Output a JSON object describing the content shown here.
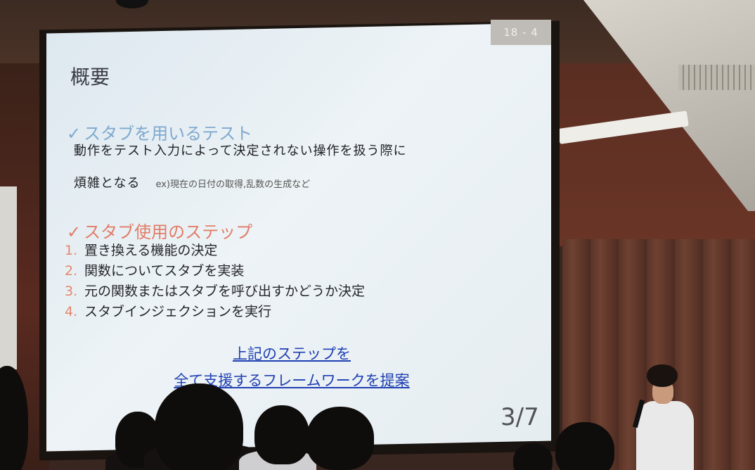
{
  "slide": {
    "slide_number": "18 - 4",
    "title": "概要",
    "section1": {
      "check": "✓",
      "heading": "スタブを用いるテスト",
      "line1": "動作をテスト入力によって決定されない操作を扱う際に",
      "line2": "煩雑となる",
      "example": "ex)現在の日付の取得,乱数の生成など"
    },
    "section2": {
      "check": "✓",
      "heading": "スタブ使用のステップ",
      "steps": [
        {
          "num": "1.",
          "text": "置き換える機能の決定"
        },
        {
          "num": "2.",
          "text": "関数についてスタブを実装"
        },
        {
          "num": "3.",
          "text": "元の関数またはスタブを呼び出すかどうか決定"
        },
        {
          "num": "4.",
          "text": "スタブインジェクションを実行"
        }
      ]
    },
    "proposal": {
      "line1": "上記のステップを",
      "line2": "全て支援するフレームワークを提案"
    },
    "page_indicator": "3/7"
  },
  "colors": {
    "section1_heading": "#7fa9cf",
    "section2_heading": "#e27c68",
    "proposal_link": "#1f3fb3",
    "step_number": "#e5856f"
  }
}
